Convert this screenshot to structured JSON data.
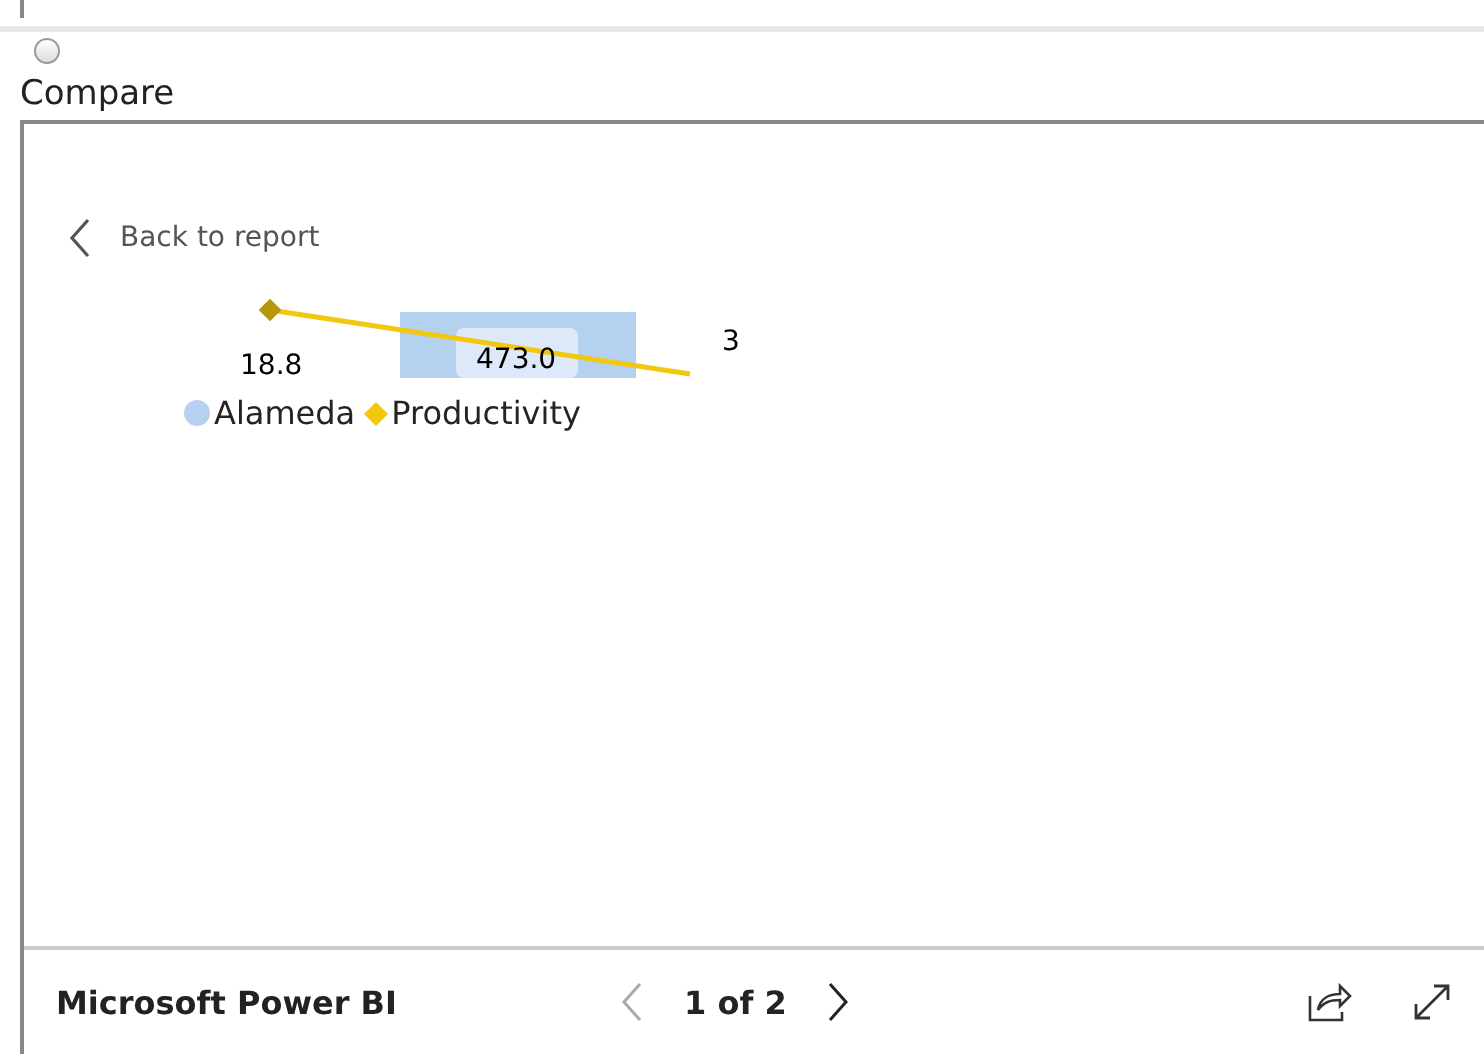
{
  "compare": {
    "label": "Compare",
    "selected": false
  },
  "back_link": "Back to report",
  "chart": {
    "data_labels": [
      "18.8",
      "473.0",
      "3"
    ],
    "legend": [
      {
        "label": "Alameda",
        "kind": "circle",
        "color": "#b5d1f0"
      },
      {
        "label": "Productivity",
        "kind": "diamond",
        "color": "#f2c80f"
      }
    ]
  },
  "footer": {
    "brand": "Microsoft Power BI",
    "page": "1 of 2",
    "prev_disabled": true,
    "next_disabled": false
  }
}
